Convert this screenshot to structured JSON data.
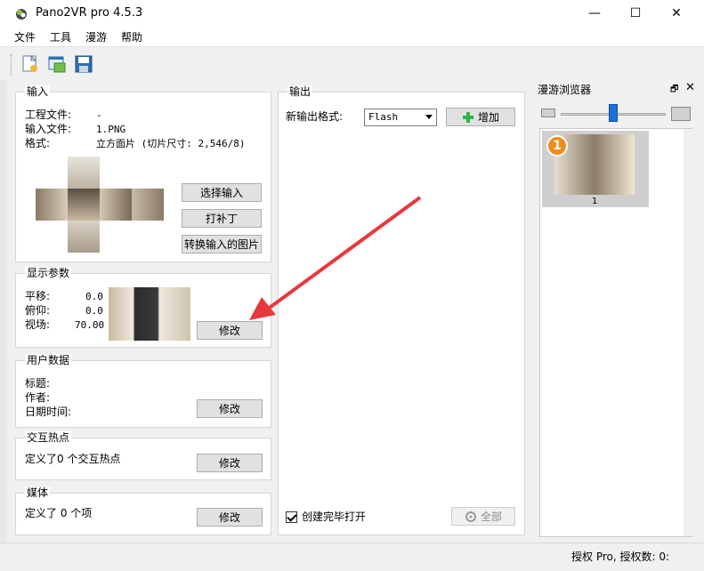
{
  "window": {
    "title": "Pano2VR pro 4.5.3",
    "min_icon": "—",
    "max_icon": "☐",
    "close_icon": "✕"
  },
  "menu": [
    "文件",
    "工具",
    "漫游",
    "帮助"
  ],
  "toolbar": [
    "new-project-icon",
    "open-project-icon",
    "save-icon"
  ],
  "input_group": {
    "title": "输入",
    "project_label": "工程文件:",
    "project_value": "-",
    "input_label": "输入文件:",
    "input_value": "1.PNG",
    "format_label": "格式:",
    "format_value": "立方面片 (切片尺寸: 2,546/8)",
    "select_input_button": "选择输入",
    "patch_button": "打补丁",
    "convert_button": "转换输入的图片"
  },
  "display_group": {
    "title": "显示参数",
    "pan_label": "平移:",
    "pan_value": "0.0",
    "tilt_label": "俯仰:",
    "tilt_value": "0.0",
    "fov_label": "视场:",
    "fov_value": "70.00",
    "modify_button": "修改"
  },
  "user_group": {
    "title": "用户数据",
    "title_label": "标题:",
    "author_label": "作者:",
    "datetime_label": "日期时间:",
    "modify_button": "修改"
  },
  "hotspot_group": {
    "title": "交互热点",
    "summary": "定义了0 个交互热点",
    "modify_button": "修改"
  },
  "media_group": {
    "title": "媒体",
    "summary": "定义了 0 个项",
    "modify_button": "修改"
  },
  "output_group": {
    "title": "输出",
    "new_format_label": "新输出格式:",
    "format_value": "Flash",
    "add_button": "增加",
    "open_when_done": "创建完毕打开",
    "all_button": "全部"
  },
  "tour_browser": {
    "title": "漫游浏览器",
    "float_icon": "🗗",
    "close_icon": "✕",
    "zoom_fraction": 0.5,
    "items": [
      {
        "badge": "1",
        "label": "1"
      }
    ]
  },
  "status": {
    "text": "授权 Pro, 授权数: 0:"
  },
  "colors": {
    "accent_blue": "#1e6fd9",
    "arrow_red": "#e8383d",
    "add_green": "#2fb34a",
    "badge_orange": "#f08c1e"
  }
}
